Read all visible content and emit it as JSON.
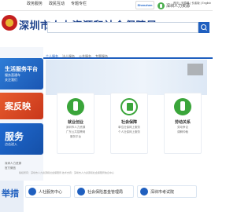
{
  "topbar": {
    "items": [
      "政务服务",
      "政民互动",
      "专题专栏"
    ],
    "shenzhen_logo_text": "Shenzhen",
    "hr_logo_text": "深圳人力资源",
    "right_links": "首页 | 无障碍 | 长者版 | English"
  },
  "header": {
    "title": "深圳市人力资源和社会保障局"
  },
  "sidebar": {
    "card1_title": "生活服务平台",
    "card1_sub": "服务直通车",
    "card1_sub2": "关注我们",
    "card2_title": "案反映",
    "card3_title": "服务",
    "card3_sub": "点击进入",
    "card4_sub": "深圳人力资源",
    "card4_sub2": "官方微信"
  },
  "tabs": [
    "个人服务",
    "法人服务",
    "公共服务",
    "专题服务"
  ],
  "services": [
    {
      "title": "就业创业",
      "desc1": "深圳市人力资源",
      "desc2": "广东公共招聘网",
      "desc3": "服务平台"
    },
    {
      "title": "社会保障",
      "desc1": "单位社保网上服务",
      "desc2": "个人社保网上服务",
      "desc3": ""
    },
    {
      "title": "劳动关系",
      "desc1": "劳动争议",
      "desc2": "调解仲裁",
      "desc3": ""
    }
  ],
  "footer_text": "版权所有：深圳市人力资源和社会保障局  技术支持：深圳市人力资源和社会保障局信息中心",
  "bottom": {
    "left_label": "举措",
    "btn1": "人社服务中心",
    "btn2": "社会保险基金管理局",
    "btn3": "深圳市考试院"
  },
  "colors": {
    "primary": "#1f5fbf",
    "title": "#1a3f8a",
    "green": "#3aa53a",
    "orange": "#e65b2e"
  }
}
